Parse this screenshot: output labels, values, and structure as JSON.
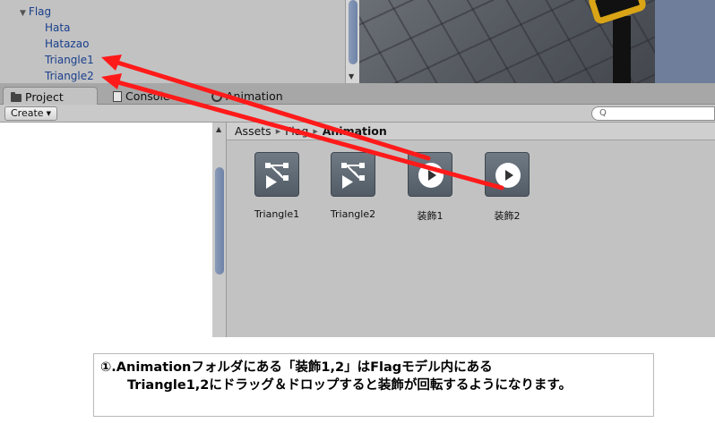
{
  "hierarchy": {
    "items": [
      {
        "label": "Flag"
      },
      {
        "label": "Hata"
      },
      {
        "label": "Hatazao"
      },
      {
        "label": "Triangle1"
      },
      {
        "label": "Triangle2"
      }
    ]
  },
  "tabs": [
    {
      "label": "Project",
      "icon": "folder-icon"
    },
    {
      "label": "Console",
      "icon": "console-icon"
    },
    {
      "label": "Animation",
      "icon": "clock-icon"
    }
  ],
  "toolbar": {
    "create_label": "Create",
    "search_placeholder": ""
  },
  "breadcrumb": [
    "Assets",
    "Flag",
    "Animation"
  ],
  "assets": [
    {
      "label": "Triangle1",
      "icon": "animator-controller-icon"
    },
    {
      "label": "Triangle2",
      "icon": "animator-controller-icon"
    },
    {
      "label": "装飾1",
      "icon": "animation-clip-icon"
    },
    {
      "label": "装飾2",
      "icon": "animation-clip-icon"
    }
  ],
  "caption": {
    "line1": "①.Animationフォルダにある「装飾1,2」はFlagモデル内にある",
    "line2": "Triangle1,2にドラッグ＆ドロップすると装飾が回転するようになります。"
  },
  "colors": {
    "arrow": "#ff1a1a",
    "hierarchy_text": "#1a3f8c"
  }
}
